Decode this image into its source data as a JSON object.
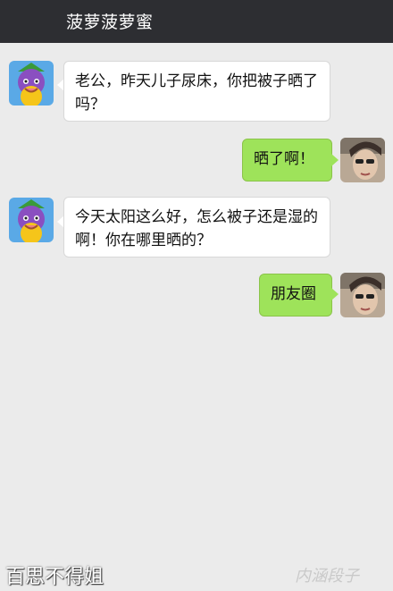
{
  "header": {
    "title": "菠萝菠萝蜜"
  },
  "messages": [
    {
      "side": "in",
      "text": "老公，昨天儿子尿床，你把被子晒了吗？"
    },
    {
      "side": "out",
      "text": "晒了啊！"
    },
    {
      "side": "in",
      "text": "今天太阳这么好，怎么被子还是湿的啊！你在哪里晒的？"
    },
    {
      "side": "out",
      "text": "朋友圈"
    }
  ],
  "watermark": {
    "left": "百思不得姐",
    "right": "内涵段子"
  },
  "colors": {
    "header_bg": "#2d2e32",
    "out_bubble": "#9ee35a",
    "in_bubble": "#ffffff",
    "background": "#ebebeb"
  }
}
